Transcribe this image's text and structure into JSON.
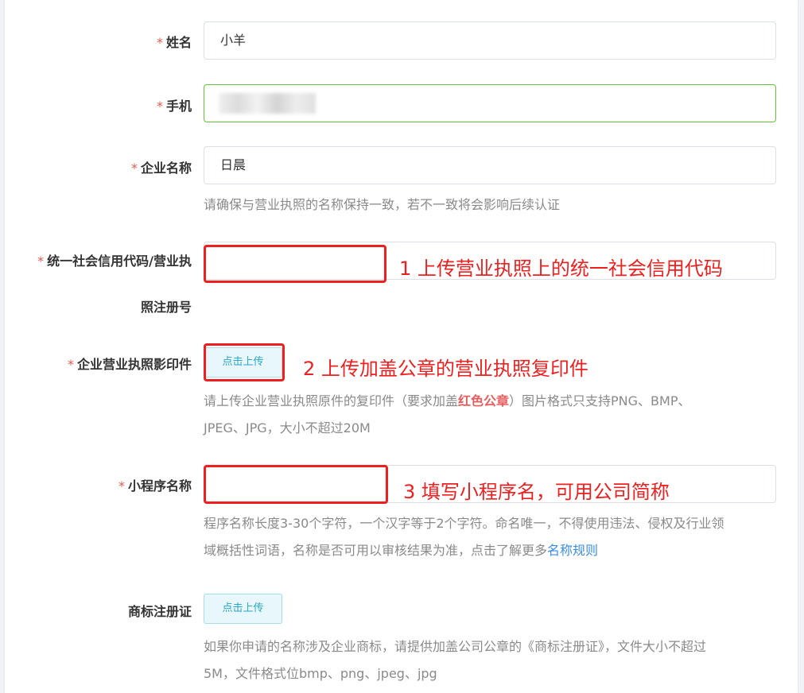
{
  "form": {
    "name": {
      "label": "姓名",
      "required": "*",
      "value": "小羊"
    },
    "phone": {
      "label": "手机",
      "required": "*"
    },
    "company": {
      "label": "企业名称",
      "required": "*",
      "value": "日晨",
      "hint": "请确保与营业执照的名称保持一致，若不一致将会影响后续认证"
    },
    "credit_code": {
      "label_line1": "统一社会信用代码/营业执",
      "label_line2": "照注册号",
      "required": "*"
    },
    "license_copy": {
      "label": "企业营业执照影印件",
      "required": "*",
      "upload_label": "点击上传",
      "hint_before": "请上传企业营业执照原件的复印件（要求加盖",
      "hint_emphasis": "红色公章",
      "hint_after": "）图片格式只支持PNG、BMP、",
      "hint_line2": "JPEG、JPG，大小不超过20M"
    },
    "mini_program": {
      "label": "小程序名称",
      "required": "*",
      "hint_line1": "程序名称长度3-30个字符，一个汉字等于2个字符。命名唯一，不得使用违法、侵权及行业领",
      "hint_line2_before": "域概括性词语，名称是否可用以审核结果为准，点击了解更多",
      "hint_link": "名称规则"
    },
    "trademark": {
      "label": "商标注册证",
      "upload_label": "点击上传",
      "hint_line1": "如果你申请的名称涉及企业商标，请提供加盖公司公章的《商标注册证》，文件大小不超过",
      "hint_line2": "5M，文件格式位bmp、png、jpeg、jpg"
    }
  },
  "annotations": {
    "a1": "1 上传营业执照上的统一社会信用代码",
    "a2": "2 上传加盖公章的营业执照复印件",
    "a3": "3 填写小程序名，可用公司简称",
    "color": "#ee1f1f"
  },
  "colors": {
    "required": "#e05a4f",
    "success_border": "#67c23a",
    "link": "#3a8ee6",
    "upload_bg": "#e8f7fb"
  }
}
